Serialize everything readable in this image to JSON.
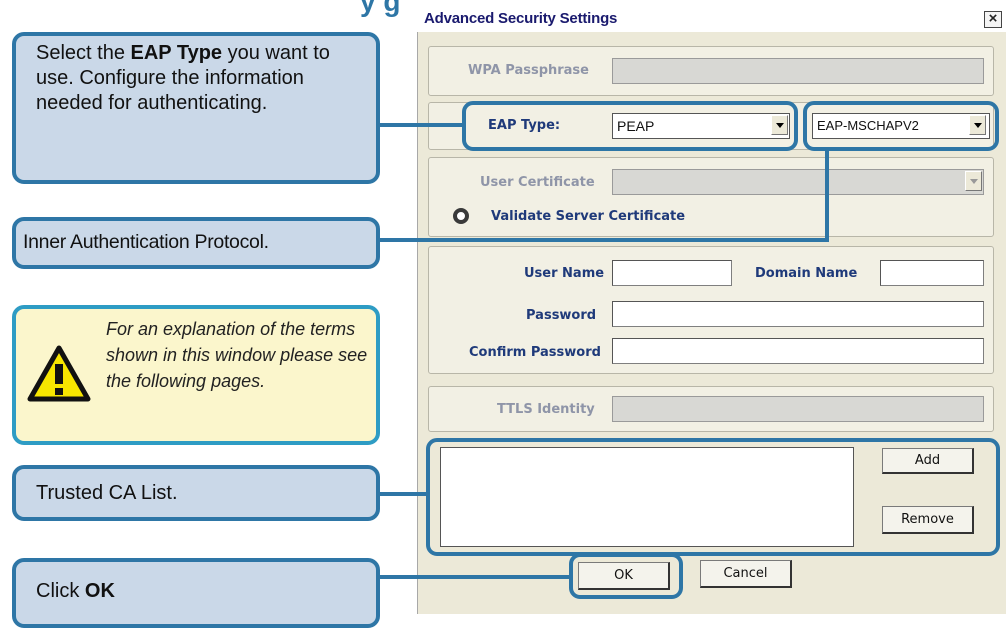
{
  "dialog": {
    "title": "Advanced Security Settings",
    "close_label": "×",
    "wpa_passphrase_label": "WPA Passphrase",
    "eap_type_label": "EAP Type:",
    "eap_type_value": "PEAP",
    "inner_auth_value": "EAP-MSCHAPV2",
    "user_certificate_label": "User Certificate",
    "validate_server_cert_label": "Validate Server Certificate",
    "user_name_label": "User Name",
    "domain_name_label": "Domain Name",
    "password_label": "Password",
    "confirm_password_label": "Confirm Password",
    "ttls_identity_label": "TTLS Identity",
    "add_label": "Add",
    "remove_label": "Remove",
    "ok_label": "OK",
    "cancel_label": "Cancel"
  },
  "callouts": {
    "eap_pre": "Select the ",
    "eap_bold": "EAP Type",
    "eap_post": " you want to use. Configure the information needed for authenticating.",
    "inner": "Inner Authentication Protocol.",
    "note": "For an explanation of the terms shown in this window please see the following pages.",
    "trusted": "Trusted CA List.",
    "ok_pre": "Click ",
    "ok_bold": "OK"
  },
  "colors": {
    "callout_border": "#2e76a6",
    "callout_fill": "#cad8e8",
    "warning_fill": "#fbf6cc",
    "warning_icon": "#f7e600",
    "dialog_bg": "#ece9d8"
  }
}
